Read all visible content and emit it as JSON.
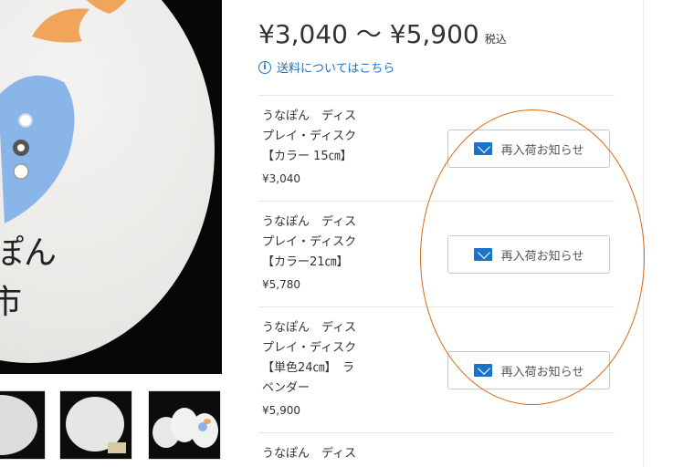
{
  "gallery": {
    "main_image_alt": "",
    "main_text_1": "ぽん",
    "main_text_2": "市"
  },
  "price_range": {
    "text": "¥3,040 〜 ¥5,900",
    "tax_label": "税込"
  },
  "shipping": {
    "icon": "i",
    "link_text": "送料についてはこちら"
  },
  "variants": [
    {
      "name_lines": [
        "うなぽん　ディス",
        "プレイ・ディスク",
        "【カラー 15㎝】"
      ],
      "price": "¥3,040",
      "button_label": "再入荷お知らせ"
    },
    {
      "name_lines": [
        "うなぽん　ディス",
        "プレイ・ディスク",
        "【カラー21㎝】"
      ],
      "price": "¥5,780",
      "button_label": "再入荷お知らせ"
    },
    {
      "name_lines": [
        "うなぽん　ディス",
        "プレイ・ディスク",
        "【単色24㎝】　ラ",
        "ベンダー"
      ],
      "price": "¥5,900",
      "button_label": "再入荷お知らせ"
    },
    {
      "name_lines": [
        "うなぽん　ディス"
      ]
    }
  ],
  "colors": {
    "accent": "#1a73c8",
    "highlight": "#d9681a"
  }
}
